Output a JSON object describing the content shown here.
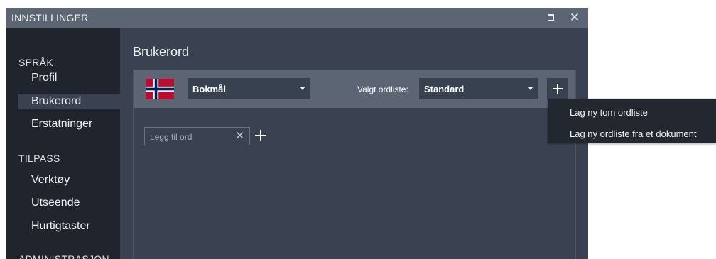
{
  "window": {
    "title": "INNSTILLINGER",
    "maximize_icon": "maximize-icon",
    "close_icon": "close-icon",
    "close_glyph": "✕"
  },
  "sidebar": {
    "sections": [
      {
        "label": "SPRÅK",
        "items": [
          {
            "label": "Profil"
          },
          {
            "label": "Brukerord",
            "active": true
          },
          {
            "label": "Erstatninger"
          }
        ]
      },
      {
        "label": "TILPASS",
        "items": [
          {
            "label": "Verktøy"
          },
          {
            "label": "Utseende"
          },
          {
            "label": "Hurtigtaster"
          }
        ]
      },
      {
        "label": "ADMINISTRASJON",
        "items": []
      }
    ]
  },
  "content": {
    "title": "Brukerord",
    "language_dropdown": {
      "value": "Bokmål",
      "flag_icon": "norway-flag-icon"
    },
    "wordlist_label": "Valgt ordliste:",
    "wordlist_dropdown": {
      "value": "Standard"
    },
    "add_wordlist_icon": "plus-icon",
    "word_input": {
      "placeholder": "Legg til ord",
      "value": "",
      "clear_glyph": "✕"
    },
    "add_word_icon": "plus-icon"
  },
  "menu": {
    "items": [
      {
        "label": "Lag ny tom ordliste"
      },
      {
        "label": "Lag ny ordliste fra et dokument"
      }
    ]
  },
  "colors": {
    "titlebar": "#5c6573",
    "sidebar": "#20252d",
    "content": "#3a4251",
    "panel_header": "#5c6574",
    "menu": "#232830",
    "flag_red": "#ba0c2f",
    "flag_blue": "#00205b"
  }
}
